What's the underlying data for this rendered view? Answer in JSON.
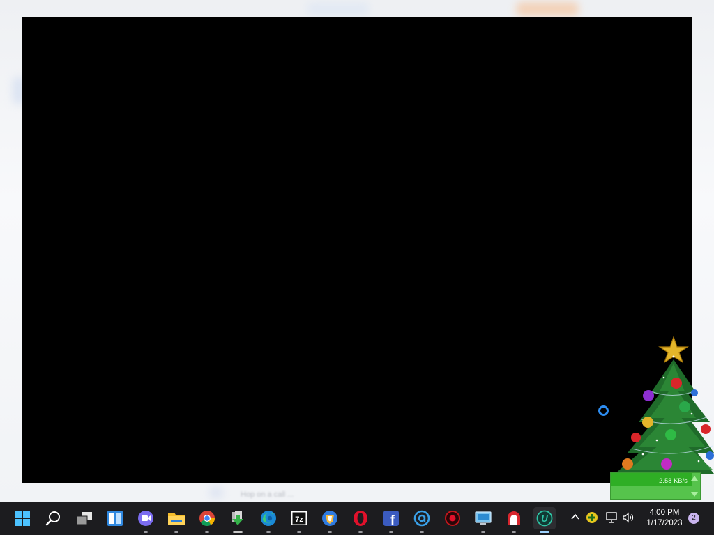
{
  "background": {
    "blurred_text": "Hop on a call ..."
  },
  "gadget": {
    "speed": "2.58 KB/s"
  },
  "taskbar": {
    "pinned": [
      {
        "name": "start",
        "icon": "windows-start-icon",
        "active": false
      },
      {
        "name": "search",
        "icon": "search-icon",
        "active": false
      },
      {
        "name": "task-view",
        "icon": "task-view-icon",
        "active": false
      },
      {
        "name": "widgets",
        "icon": "widgets-icon",
        "active": false
      },
      {
        "name": "teams-chat",
        "icon": "teams-chat-icon",
        "active": false
      },
      {
        "name": "file-explorer",
        "icon": "folder-icon",
        "active": false
      },
      {
        "name": "chrome",
        "icon": "chrome-icon",
        "active": false
      },
      {
        "name": "download-manager",
        "icon": "download-manager-icon",
        "active": false
      },
      {
        "name": "edge",
        "icon": "edge-icon",
        "active": false
      },
      {
        "name": "7zip",
        "icon": "7zip-icon",
        "label": "7z",
        "active": false
      },
      {
        "name": "brave-browser",
        "icon": "brave-icon",
        "active": false
      },
      {
        "name": "opera",
        "icon": "opera-icon",
        "active": false
      },
      {
        "name": "facebook",
        "icon": "facebook-icon",
        "label": "f",
        "active": false
      },
      {
        "name": "mail-client",
        "icon": "mail-at-icon",
        "active": false
      },
      {
        "name": "screen-recorder",
        "icon": "recorder-icon",
        "active": false
      },
      {
        "name": "remote-desktop",
        "icon": "remote-desktop-icon",
        "active": false
      },
      {
        "name": "pdf-tool",
        "icon": "pdf-icon",
        "active": false
      },
      {
        "name": "vpn-app",
        "icon": "vpn-u-icon",
        "label": "U",
        "active": true
      }
    ],
    "tray": {
      "clock_time": "4:00 PM",
      "clock_date": "1/17/2023",
      "notification_count": "2"
    }
  },
  "colors": {
    "taskbar": "#1c1c1f",
    "viewer": "#000000",
    "accent_blue": "#2d8cf0"
  }
}
